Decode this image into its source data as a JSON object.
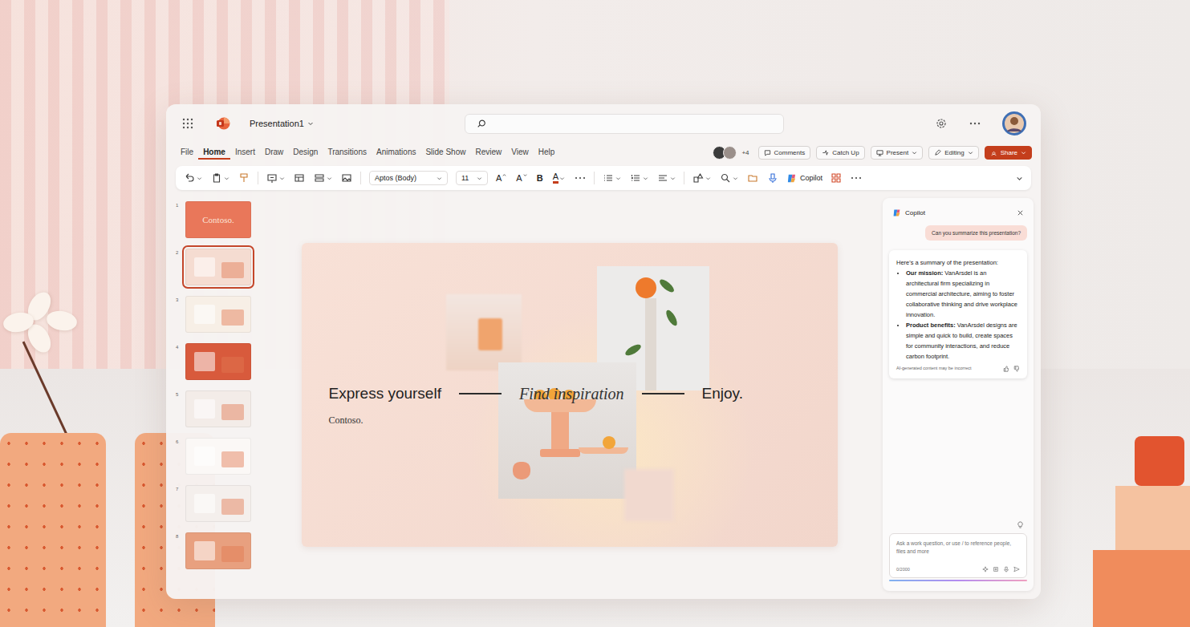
{
  "window": {
    "title": "Presentation1"
  },
  "menu": {
    "tabs": [
      {
        "label": "File",
        "selected": false
      },
      {
        "label": "Home",
        "selected": true
      },
      {
        "label": "Insert",
        "selected": false
      },
      {
        "label": "Draw",
        "selected": false
      },
      {
        "label": "Design",
        "selected": false
      },
      {
        "label": "Transitions",
        "selected": false
      },
      {
        "label": "Animations",
        "selected": false
      },
      {
        "label": "Slide Show",
        "selected": false
      },
      {
        "label": "Review",
        "selected": false
      },
      {
        "label": "View",
        "selected": false
      },
      {
        "label": "Help",
        "selected": false
      }
    ]
  },
  "collaborators": {
    "avatars": [
      {
        "color": "#3b3b3b"
      },
      {
        "color": "#9a8f8a"
      }
    ],
    "more": "+4"
  },
  "actions": [
    {
      "label": "Comments",
      "kind": "comments"
    },
    {
      "label": "Catch Up",
      "kind": "catchup"
    },
    {
      "label": "Present",
      "kind": "present"
    },
    {
      "label": "Editing",
      "kind": "editing"
    },
    {
      "label": "Share",
      "kind": "share"
    }
  ],
  "ribbon": {
    "font": "Aptos (Body)",
    "size": "11",
    "format_buttons": [
      {
        "label": "A",
        "kind": "grow"
      },
      {
        "label": "A",
        "kind": "shrink"
      },
      {
        "label": "B",
        "kind": "bold"
      },
      {
        "label": "A",
        "kind": "color"
      }
    ],
    "copilot": "Copilot"
  },
  "slides": [
    {
      "number": "1",
      "selected": false,
      "color": "#e9775a",
      "caption": "Contoso."
    },
    {
      "number": "2",
      "selected": true,
      "color": "#f5dcd1"
    },
    {
      "number": "3",
      "selected": false,
      "color": "#f7efe6"
    },
    {
      "number": "4",
      "selected": false,
      "color": "#d85a3c"
    },
    {
      "number": "5",
      "selected": false,
      "color": "#f3ece8"
    },
    {
      "number": "6",
      "selected": false,
      "color": "#fbf8f6"
    },
    {
      "number": "7",
      "selected": false,
      "color": "#f4efec"
    },
    {
      "number": "8",
      "selected": false,
      "color": "#e8a07f"
    }
  ],
  "slide": {
    "phrases": [
      {
        "text": "Express yourself",
        "kind": "sans"
      },
      {
        "text": "Find inspiration",
        "kind": "serif"
      },
      {
        "text": "Enjoy.",
        "kind": "sans"
      }
    ],
    "brand": "Contoso."
  },
  "copilot": {
    "title": "Copilot",
    "prompt": "Can you summarize this presentation?",
    "intro": "Here's a summary of the presentation:",
    "points": [
      {
        "label": "Our mission:",
        "text": "VanArsdel is an architectural firm specializing in commercial architecture, aiming to foster collaborative thinking and drive workplace innovation."
      },
      {
        "label": "Product benefits:",
        "text": "VanArsdel designs are simple and quick to build, create spaces for community interactions, and reduce carbon footprint."
      }
    ],
    "disclaimer": "AI-generated content may be incorrect",
    "input_placeholder": "Ask a work question, or use / to reference people, files and more",
    "counter": "0/2000"
  }
}
